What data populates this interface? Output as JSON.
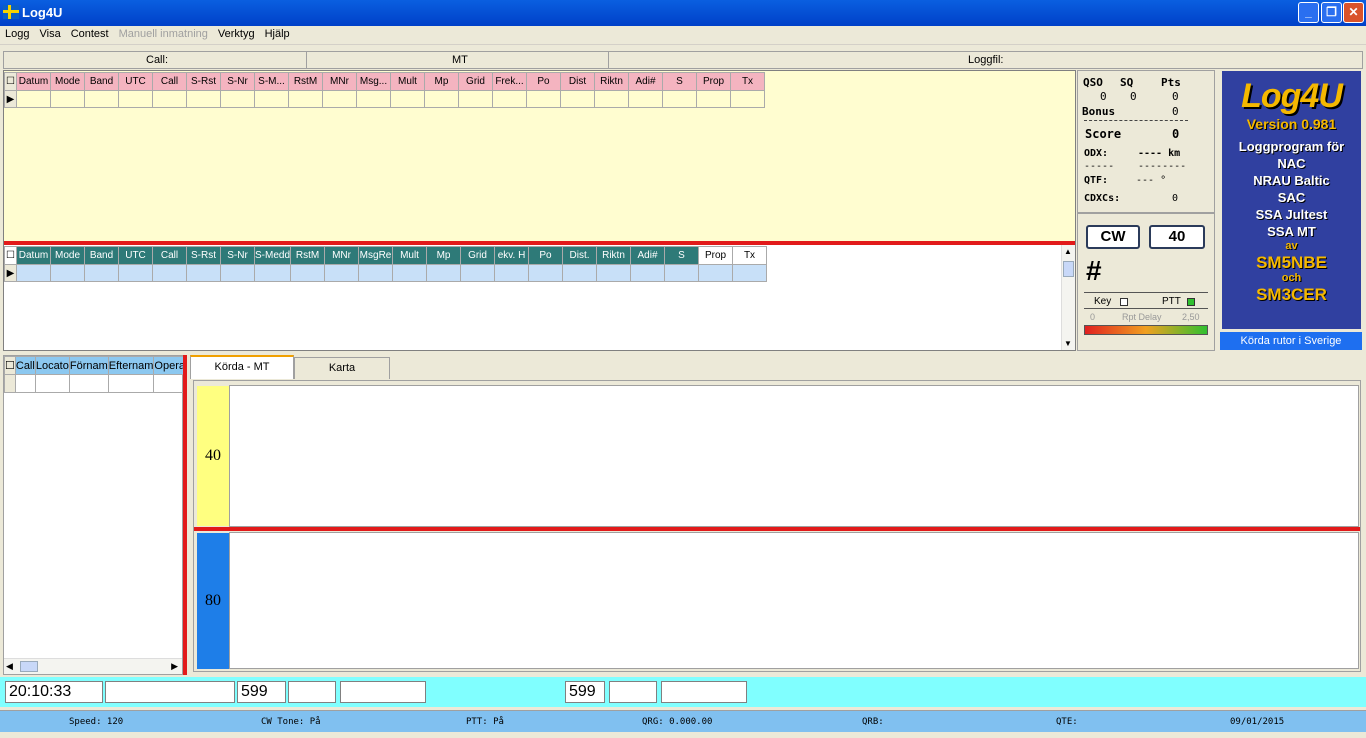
{
  "window": {
    "title": "Log4U"
  },
  "menu": [
    "Logg",
    "Visa",
    "Contest",
    "Manuell inmatning",
    "Verktyg",
    "Hjälp"
  ],
  "menu_disabled": [
    false,
    false,
    false,
    true,
    false,
    false
  ],
  "header": {
    "call": "Call:",
    "contest": "MT",
    "logfile": "Loggfil:"
  },
  "log_columns": [
    "Datum",
    "Mode",
    "Band",
    "UTC",
    "Call",
    "S-Rst",
    "S-Nr",
    "S-M...",
    "RstM",
    "MNr",
    "Msg...",
    "Mult",
    "Mp",
    "Grid",
    "Frek...",
    "Po",
    "Dist",
    "Riktn",
    "Adi#",
    "S",
    "Prop",
    "Tx"
  ],
  "entry_columns": [
    "Datum",
    "Mode",
    "Band",
    "UTC",
    "Call",
    "S-Rst",
    "S-Nr",
    "S-Medd",
    "RstM",
    "MNr",
    "MsgRe",
    "Mult",
    "Mp",
    "Grid",
    "ekv. H",
    "Po",
    "Dist.",
    "Riktn",
    "Adi#",
    "S",
    "Prop",
    "Tx"
  ],
  "stats": {
    "qso_label": "QSO",
    "sq_label": "SQ",
    "pts_label": "Pts",
    "qso": "0",
    "sq": "0",
    "pts": "0",
    "bonus_label": "Bonus",
    "bonus": "0",
    "score_label": "Score",
    "score": "0",
    "odx_label": "ODX:",
    "odx": "---- km",
    "dash1": "-----",
    "dash2": "--------",
    "qtf_label": "QTF:",
    "qtf": "--- °",
    "cdxc_label": "CDXCs:",
    "cdxc": "0",
    "mode": "CW",
    "band": "40",
    "hash": "#",
    "key_label": "Key",
    "ptt_label": "PTT",
    "rpt_min": "0",
    "rpt_label": "Rpt Delay",
    "rpt_max": "2,50"
  },
  "logo": {
    "name": "Log4U",
    "version": "Version 0.981",
    "line1": "Loggprogram för",
    "line2": "NAC",
    "line3": "NRAU Baltic",
    "line4": "SAC",
    "line5": "SSA Jultest",
    "line6": "SSA MT",
    "av": "av",
    "author1": "SM5NBE",
    "och": "och",
    "author2": "SM3CER",
    "caption": "Körda rutor i Sverige"
  },
  "left_columns": [
    "Call",
    "Locato",
    "Förnam",
    "Efternam",
    "Opera"
  ],
  "tabs": [
    "Körda - MT",
    "Karta"
  ],
  "bands": [
    "40",
    "80"
  ],
  "colors": {
    "band40": "#ffff80",
    "band80": "#1e7ee8"
  },
  "entry": {
    "time": "20:10:33",
    "rst_sent": "599",
    "rst_rcvd": "599"
  },
  "status": {
    "speed": "Speed: 120",
    "cwtone": "CW Tone: På",
    "ptt": "PTT: På",
    "qrg": "QRG: 0.000.00",
    "qrb": "QRB:",
    "qte": "QTE:",
    "date": "09/01/2015"
  }
}
